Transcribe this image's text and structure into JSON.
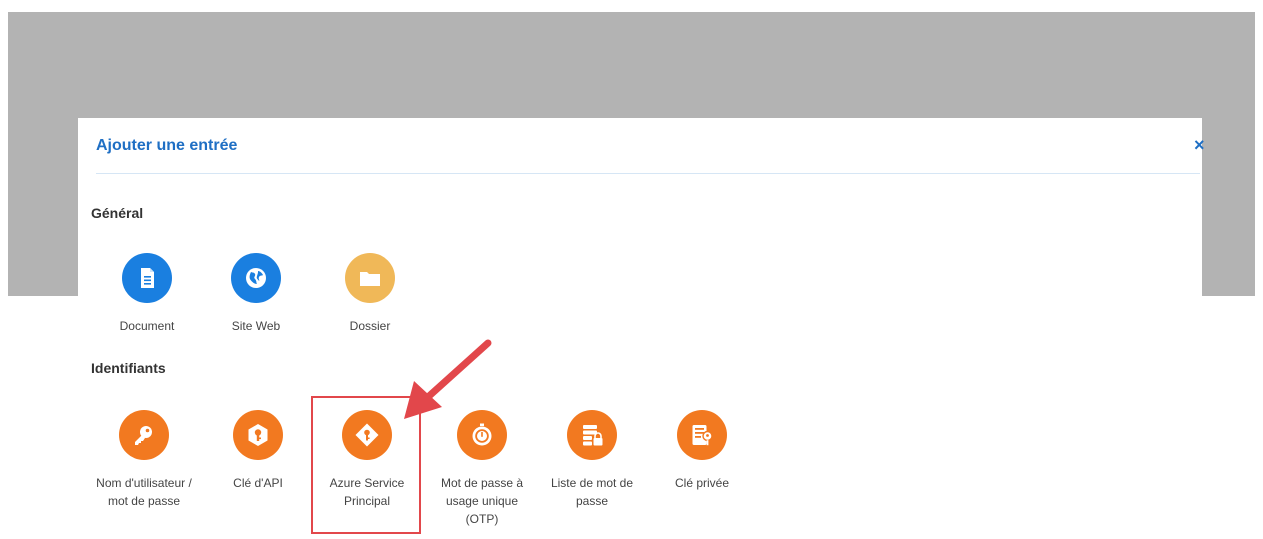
{
  "dialog": {
    "title": "Ajouter une entrée",
    "close_glyph": "×"
  },
  "sections": [
    {
      "title": "Général",
      "items": [
        {
          "label": "Document",
          "icon": "document-icon",
          "color": "#1a7fe0"
        },
        {
          "label": "Site Web",
          "icon": "globe-icon",
          "color": "#1a7fe0"
        },
        {
          "label": "Dossier",
          "icon": "folder-icon",
          "color": "#f0b858"
        }
      ]
    },
    {
      "title": "Identifiants",
      "items": [
        {
          "label": "Nom d'utilisateur / mot de passe",
          "icon": "key-icon",
          "color": "#f27920"
        },
        {
          "label": "Clé d'API",
          "icon": "api-key-icon",
          "color": "#f27920"
        },
        {
          "label": "Azure Service Principal",
          "icon": "azure-key-icon",
          "color": "#f27920"
        },
        {
          "label": "Mot de passe à usage unique (OTP)",
          "icon": "otp-timer-icon",
          "color": "#f27920"
        },
        {
          "label": "Liste de mot de passe",
          "icon": "password-list-icon",
          "color": "#f27920"
        },
        {
          "label": "Clé privée",
          "icon": "private-key-icon",
          "color": "#f27920"
        }
      ]
    }
  ],
  "annotation": {
    "highlighted_item": "Azure Service Principal",
    "highlight_color": "#e2474b"
  }
}
